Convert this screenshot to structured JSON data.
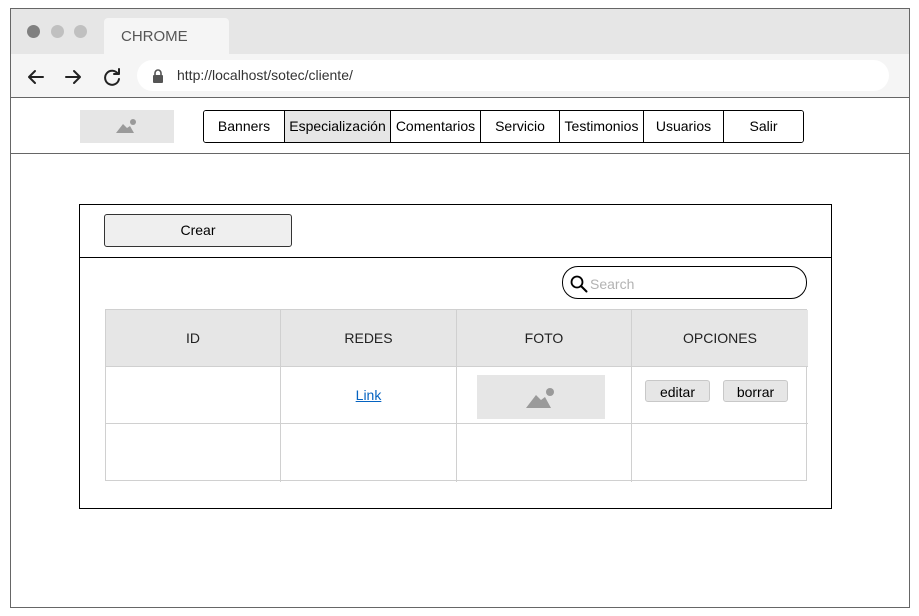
{
  "browser": {
    "tab_title": "CHROME",
    "url": "http://localhost/sotec/cliente/"
  },
  "nav": {
    "items": [
      {
        "label": "Banners",
        "active": false
      },
      {
        "label": "Especialización",
        "active": true
      },
      {
        "label": "Comentarios",
        "active": false
      },
      {
        "label": "Servicio",
        "active": false
      },
      {
        "label": "Testimonios",
        "active": false
      },
      {
        "label": "Usuarios",
        "active": false
      },
      {
        "label": "Salir",
        "active": false
      }
    ]
  },
  "panel": {
    "create_label": "Crear",
    "search_placeholder": "Search"
  },
  "table": {
    "headers": [
      "ID",
      "REDES",
      "FOTO",
      "OPCIONES"
    ],
    "rows": [
      {
        "id": "",
        "redes_link": "Link",
        "edit_label": "editar",
        "delete_label": "borrar"
      },
      {
        "id": "",
        "redes_link": "",
        "edit_label": "",
        "delete_label": ""
      }
    ]
  },
  "colors": {
    "accent_gray": "#e6e6e6",
    "link": "#0563c1",
    "border": "#000000"
  },
  "icons": [
    "back-arrow-icon",
    "forward-arrow-icon",
    "reload-icon",
    "lock-icon",
    "image-placeholder-icon",
    "search-icon"
  ]
}
